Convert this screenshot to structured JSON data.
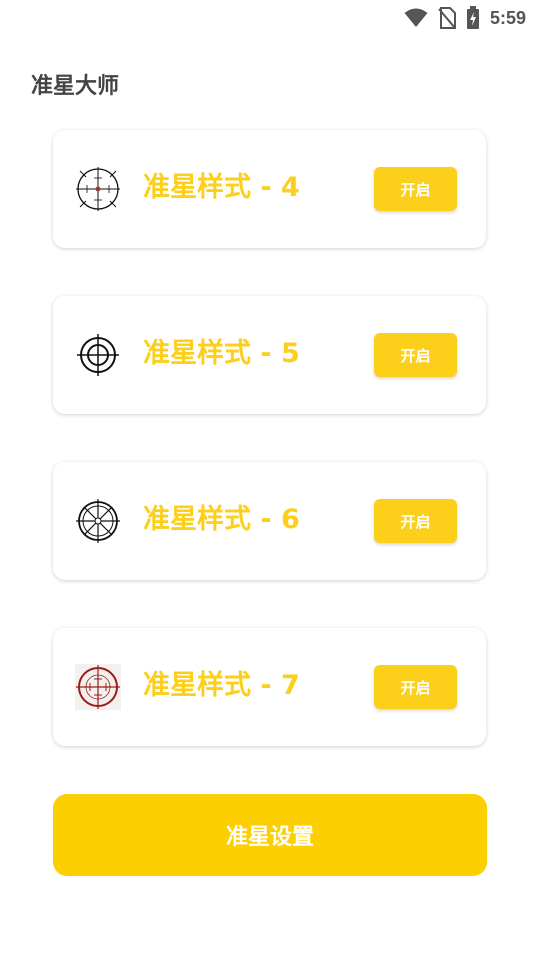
{
  "status_bar": {
    "time": "5:59",
    "icons": [
      "wifi-icon",
      "no-sim-icon",
      "battery-charging-icon"
    ]
  },
  "app": {
    "title": "准星大师"
  },
  "styles": [
    {
      "label": "准星样式 - 4",
      "button": "开启",
      "icon": "crosshair-style-4-icon"
    },
    {
      "label": "准星样式 - 5",
      "button": "开启",
      "icon": "crosshair-style-5-icon"
    },
    {
      "label": "准星样式 - 6",
      "button": "开启",
      "icon": "crosshair-style-6-icon"
    },
    {
      "label": "准星样式 - 7",
      "button": "开启",
      "icon": "crosshair-style-7-icon"
    }
  ],
  "settings_button": {
    "label": "准星设置"
  },
  "colors": {
    "accent": "#FCCF1B",
    "title_text": "#444444",
    "crosshair_7": "#9B1C1C"
  }
}
